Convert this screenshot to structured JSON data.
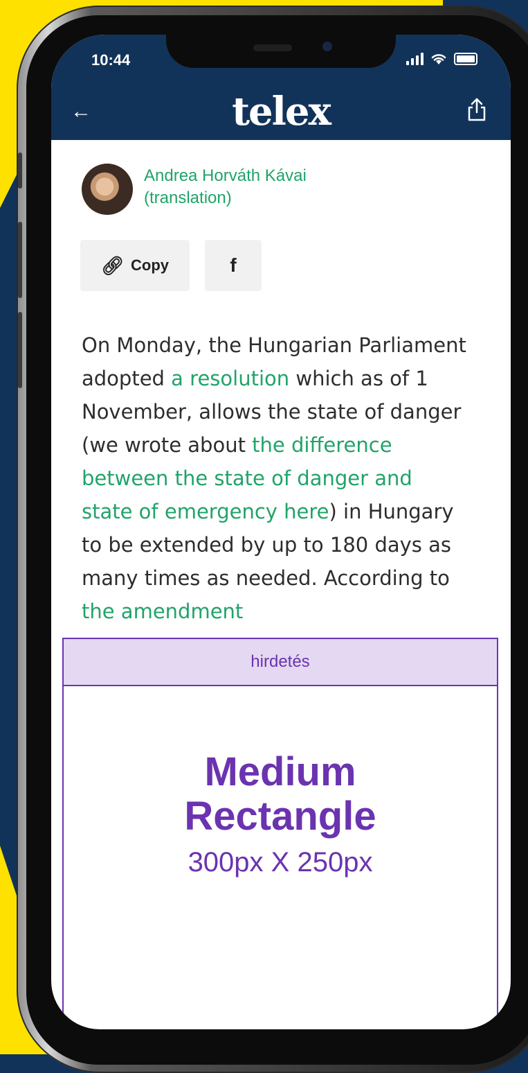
{
  "status_bar": {
    "time": "10:44"
  },
  "header": {
    "logo": "telex"
  },
  "author": {
    "name": "Andrea Horváth Kávai",
    "role": "(translation)"
  },
  "share_buttons": {
    "copy_label": "Copy",
    "facebook_label": "f"
  },
  "article": {
    "segments": [
      {
        "text": "On Monday, the Hungarian Parliament adopted ",
        "link": false
      },
      {
        "text": "a resolution",
        "link": true
      },
      {
        "text": " which as of 1 November, allows the state of danger (we wrote about ",
        "link": false
      },
      {
        "text": "the difference between the state of danger and state of emergency here",
        "link": true
      },
      {
        "text": ") in Hungary to be extended by up to 180 days as many times as needed. According to ",
        "link": false
      },
      {
        "text": "the amendment",
        "link": true
      }
    ]
  },
  "ad": {
    "label": "hirdetés",
    "title_line1": "Medium",
    "title_line2": "Rectangle",
    "size": "300px X 250px"
  },
  "colors": {
    "navy": "#123359",
    "yellow": "#ffe100",
    "green": "#21a369",
    "purple": "#6b33b0"
  }
}
